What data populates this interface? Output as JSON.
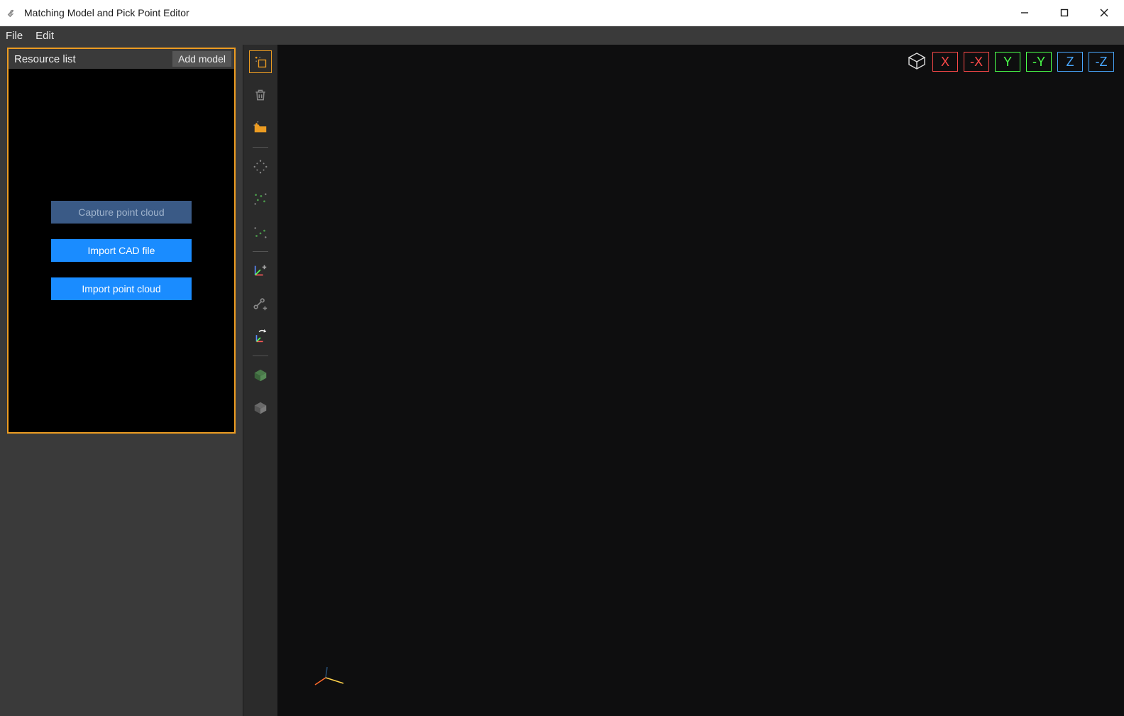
{
  "titlebar": {
    "title": "Matching Model and Pick Point Editor"
  },
  "menubar": {
    "file": "File",
    "edit": "Edit"
  },
  "resource_panel": {
    "title": "Resource list",
    "add_model": "Add model",
    "capture_point_cloud": "Capture point cloud",
    "import_cad_file": "Import CAD file",
    "import_point_cloud": "Import point cloud"
  },
  "axes": {
    "x_pos": "X",
    "x_neg": "-X",
    "y_pos": "Y",
    "y_neg": "-Y",
    "z_pos": "Z",
    "z_neg": "-Z"
  },
  "colors": {
    "accent_orange": "#ec9c22",
    "primary_blue": "#1a8cff",
    "axis_x": "#ff4a4a",
    "axis_y": "#4aff4a",
    "axis_z": "#4aa8ff"
  }
}
